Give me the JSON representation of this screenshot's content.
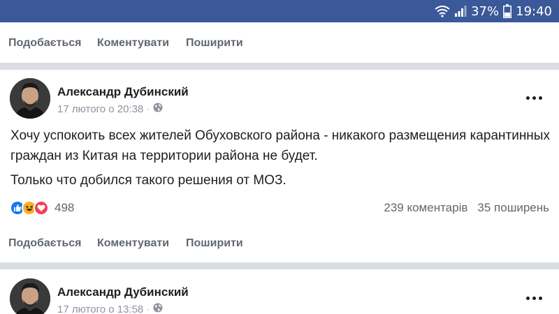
{
  "status_bar": {
    "battery_percent": "37%",
    "time": "19:40",
    "icons": [
      "wifi-icon",
      "signal-icon",
      "battery-icon"
    ]
  },
  "actions": {
    "like": "Подобається",
    "comment": "Коментувати",
    "share": "Поширити"
  },
  "posts": [
    {
      "author": "Александр Дубинский",
      "date": "17 лютого о 20:38",
      "separator": "·",
      "privacy_icon": "globe-icon",
      "text_paragraphs": [
        "Хочу успокоить всех жителей Обуховского района - никакого размещения карантинных граждан из Китая на территории района не будет.",
        "Только что добился такого решения от МОЗ."
      ],
      "reaction_count": "498",
      "reaction_icons": [
        "like-icon",
        "haha-icon",
        "love-icon"
      ],
      "comments": "239 коментарів",
      "shares": "35 поширень"
    },
    {
      "author": "Александр Дубинский",
      "date": "17 лютого о 13:58",
      "separator": "·",
      "privacy_icon": "globe-icon"
    }
  ],
  "colors": {
    "status_bar": "#3b5998",
    "separator": "#dadde1",
    "secondary_text": "#606770",
    "like": "#1877f2",
    "haha": "#f7b125",
    "love": "#f33e58"
  }
}
